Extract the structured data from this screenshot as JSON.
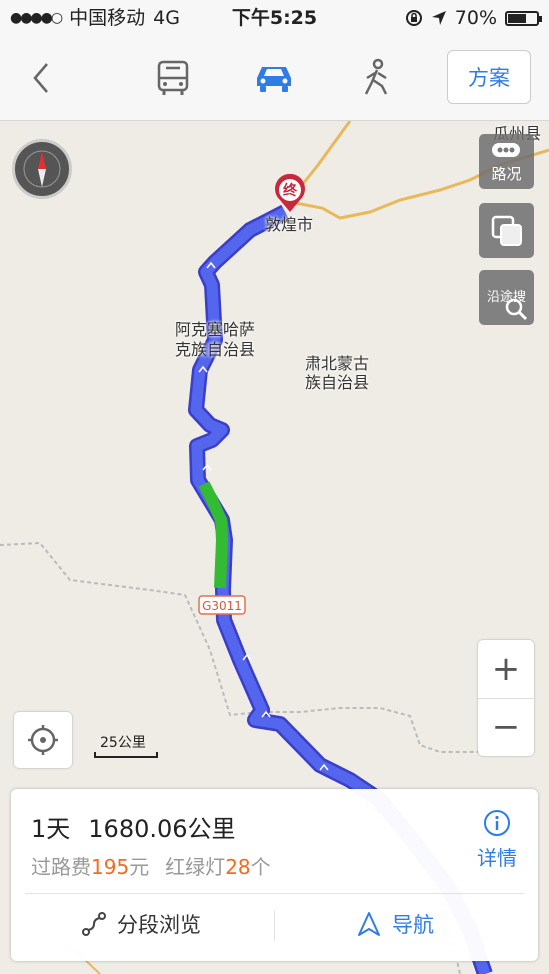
{
  "status_bar": {
    "signal_dots": "●●●●○",
    "carrier": "中国移动",
    "network": "4G",
    "time": "下午5:25",
    "battery_percent": "70%",
    "battery_level": 0.7
  },
  "nav_bar": {
    "plan_label": "方案",
    "active_mode": "car",
    "accent_color": "#2f7ce5"
  },
  "map": {
    "labels": {
      "gua_zhou": "瓜州县",
      "dunhuang": "敦煌市",
      "akesai_1": "阿克塞哈萨",
      "akesai_2": "克族自治县",
      "subei_1": "肃北蒙古",
      "subei_2": "族自治县",
      "road_g3011": "G3011"
    },
    "end_marker": "终",
    "route_color": "#5566ee",
    "congestion_color": "#33bb33"
  },
  "controls": {
    "traffic_label": "路况",
    "along_search_label": "沿途搜",
    "zoom_in": "+",
    "zoom_out": "−",
    "scale_text": "25公里"
  },
  "route_card": {
    "duration": "1天",
    "distance": "1680.06公里",
    "toll_label": "过路费",
    "toll_amount": "195",
    "toll_unit": "元",
    "lights_label": "红绿灯",
    "lights_count": "28",
    "lights_unit": "个",
    "detail_label": "详情",
    "segment_browse_label": "分段浏览",
    "navigate_label": "导航"
  }
}
